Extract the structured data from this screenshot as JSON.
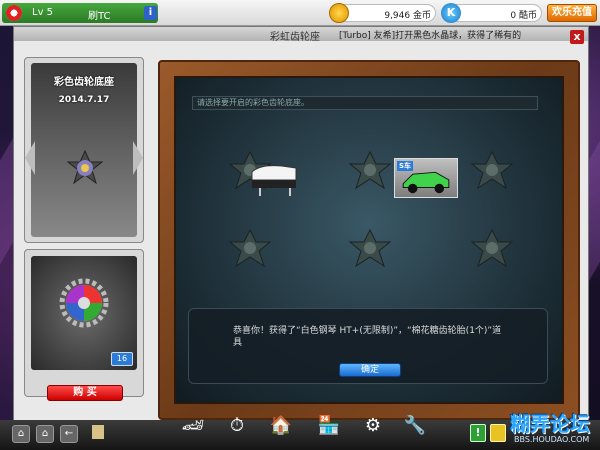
{
  "topbar": {
    "level": "Lv 5",
    "player_name": "刷TC",
    "info_label": "i",
    "coins": "9,946",
    "coins_unit": "金币",
    "k_icon_label": "K",
    "tickets": "0",
    "tickets_unit": "酷币",
    "recharge_label": "欢乐充值"
  },
  "dialog": {
    "title": "彩虹齿轮座",
    "ticker": "[Turbo] 友希]打开黑色水晶球，获得了稀有的",
    "close_label": "x"
  },
  "left": {
    "item_name": "彩色齿轮底座",
    "item_date": "2014.7.17",
    "gear_count": "16",
    "buy_label": "购 买"
  },
  "board": {
    "hint": "请选择要开启的彩色齿轮底座。",
    "car_badge": "S车",
    "popup_text": "恭喜你！获得了“白色钢琴 HT+(无限制)”，“棉花糖齿轮胎(1个)”道具",
    "ok_label": "确定"
  },
  "bottombar": {
    "icons": [
      "⌂",
      "⌂",
      "←"
    ],
    "main_icons": [
      "kart-icon",
      "speedometer-icon",
      "garage-icon",
      "shop-icon",
      "gear-settings-icon",
      "tools-icon"
    ],
    "green_label": "!"
  },
  "watermark": {
    "main": "糊弄论坛",
    "sub": "BBS.HOUDAO.COM"
  }
}
